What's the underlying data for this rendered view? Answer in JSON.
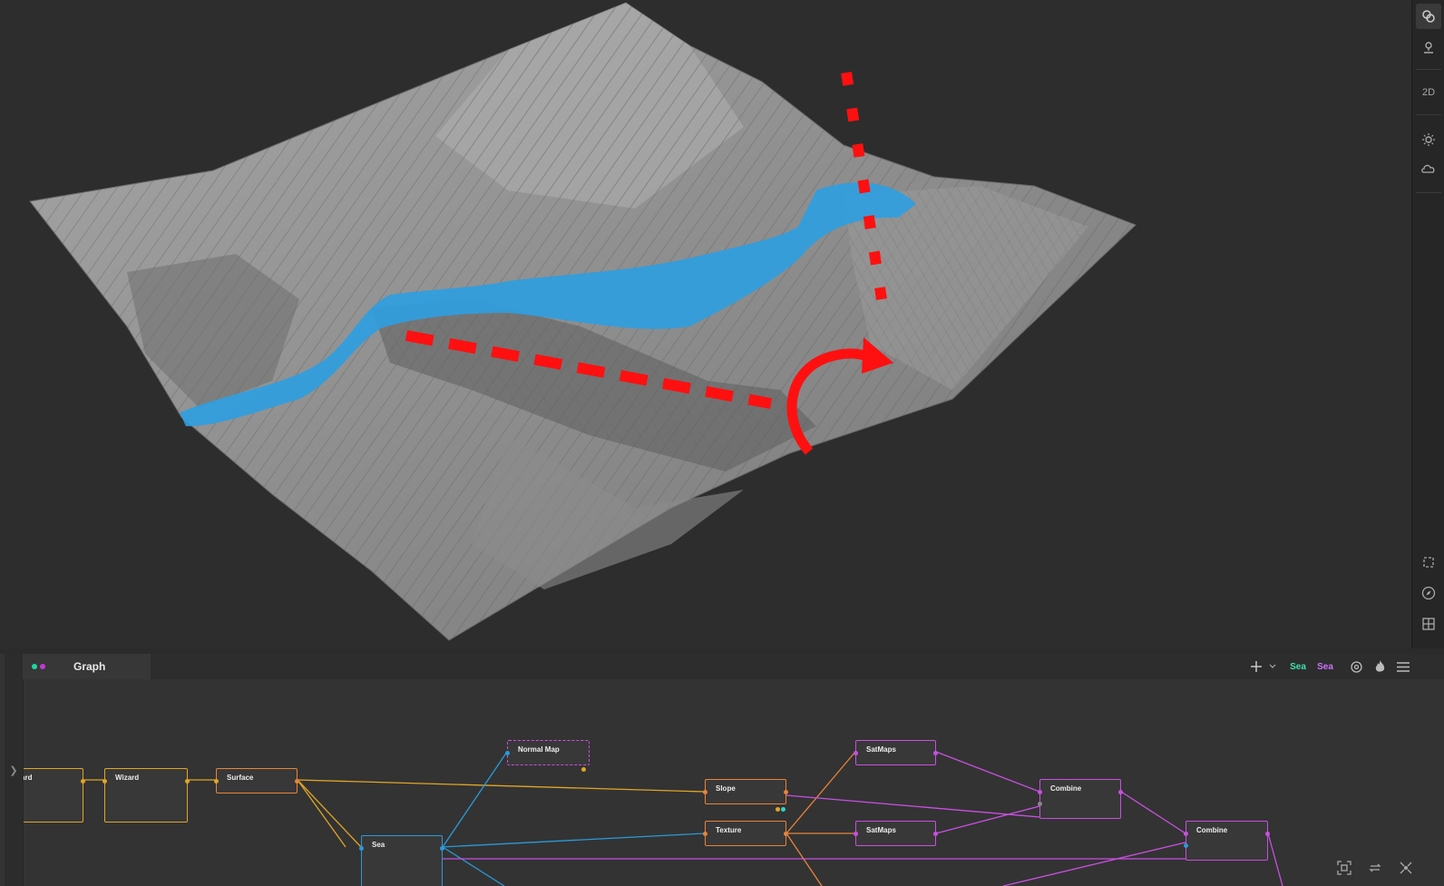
{
  "toolbar": {
    "items": [
      {
        "name": "link-icon",
        "active": true
      },
      {
        "name": "pin-icon",
        "active": false
      },
      {
        "name": "view-2d-button",
        "label": "2D"
      },
      {
        "name": "sun-icon",
        "active": false
      },
      {
        "name": "cloud-icon",
        "active": false
      },
      {
        "name": "frame-icon",
        "active": false
      },
      {
        "name": "compass-icon",
        "active": false
      },
      {
        "name": "grid-icon",
        "active": false
      }
    ],
    "label_2d": "2D"
  },
  "graph": {
    "tab_title": "Graph",
    "tab_dot_colors": [
      "#1fd6a0",
      "#c23ad6"
    ],
    "header_tools": {
      "add_icon": "plus-icon",
      "dropdown_icon": "chevron-down-icon",
      "tag_1": "Sea",
      "tag_1_color": "#3ee0b0",
      "tag_2": "Sea",
      "tag_2_color": "#d070ff"
    },
    "nodes": {
      "ard": "ard",
      "wizard": "Wizard",
      "surface": "Surface",
      "normal_map": "Normal Map",
      "sea": "Sea",
      "slope": "Slope",
      "texture": "Texture",
      "satmaps_1": "SatMaps",
      "satmaps_2": "SatMaps",
      "combine_1": "Combine",
      "combine_2": "Combine"
    },
    "colors": {
      "yellow": "#e0a526",
      "orange": "#e8833a",
      "blue": "#2a9ad8",
      "purple": "#c850e0"
    }
  }
}
